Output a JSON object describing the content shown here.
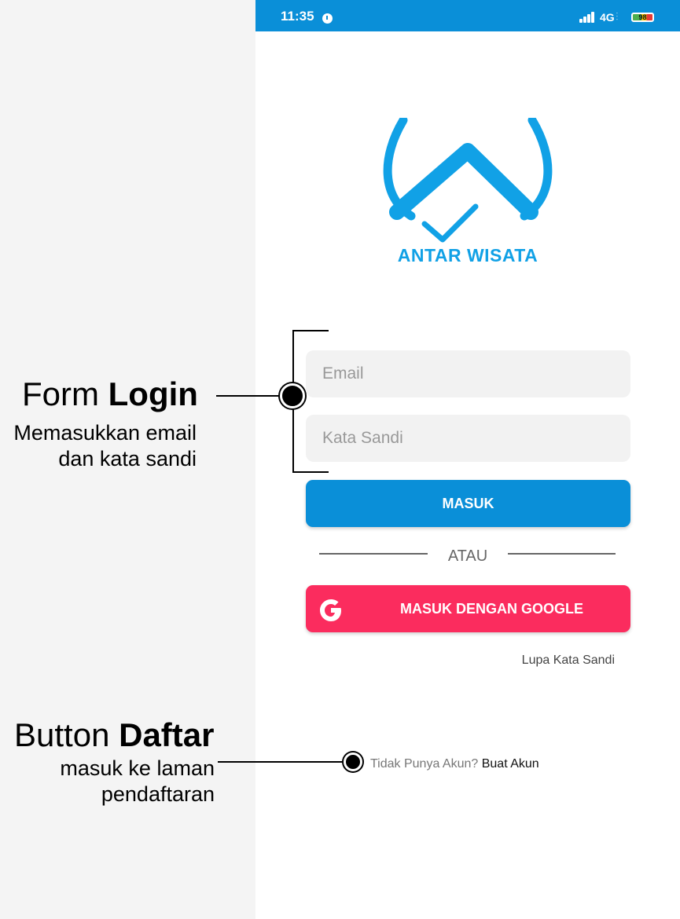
{
  "status_bar": {
    "time": "11:35",
    "network": "4G",
    "battery": "98"
  },
  "logo": {
    "text": "ANTAR WISATA"
  },
  "form": {
    "email_placeholder": "Email",
    "password_placeholder": "Kata Sandi",
    "login_button": "MASUK",
    "divider": "ATAU",
    "google_button": "MASUK DENGAN GOOGLE",
    "forgot_password": "Lupa Kata Sandi",
    "no_account": "Tidak Punya Akun?",
    "create_account": "Buat Akun"
  },
  "annotations": {
    "form_title_1": "Form ",
    "form_title_2": "Login",
    "form_desc_1": "Memasukkan email",
    "form_desc_2": "dan kata sandi",
    "button_title_1": "Button ",
    "button_title_2": "Daftar",
    "button_desc_1": "masuk ke laman",
    "button_desc_2": "pendaftaran"
  },
  "colors": {
    "primary": "#0a8fd8",
    "google": "#fb2c5e",
    "logo": "#11a1e6"
  },
  "icons": [
    "clock-icon",
    "signal-icon",
    "battery-icon",
    "google-icon"
  ]
}
